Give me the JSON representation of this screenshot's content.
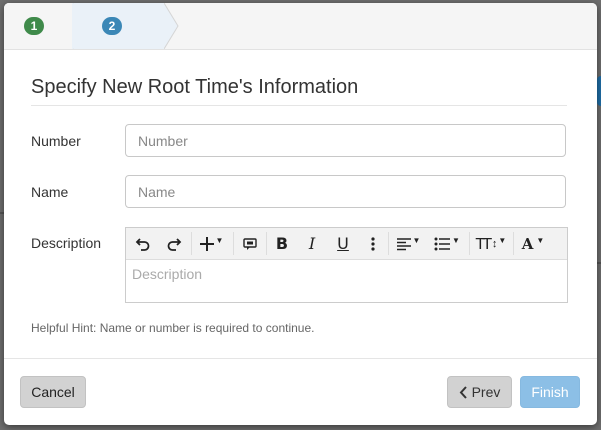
{
  "wizard": {
    "steps": [
      {
        "number": "1",
        "state": "complete",
        "color": "#3f8a4a"
      },
      {
        "number": "2",
        "state": "active",
        "color": "#3b87b6"
      }
    ]
  },
  "form": {
    "title": "Specify New Root Time's Information",
    "number": {
      "label": "Number",
      "placeholder": "Number",
      "value": ""
    },
    "name": {
      "label": "Name",
      "placeholder": "Name",
      "value": ""
    },
    "description": {
      "label": "Description",
      "placeholder": "Description"
    },
    "hint": "Helpful Hint: Name or number is required to continue."
  },
  "toolbar": {
    "undo_icon": "undo-icon",
    "redo_icon": "redo-icon",
    "insert_icon": "plus-icon",
    "comment_icon": "comment-icon",
    "bold": "B",
    "italic": "I",
    "underline": "U",
    "more_icon": "vertical-dots-icon",
    "align_icon": "align-left-icon",
    "list_icon": "bulleted-list-icon",
    "font_size": "TT",
    "font_color": "A"
  },
  "footer": {
    "cancel_label": "Cancel",
    "prev_label": "Prev",
    "finish_label": "Finish"
  },
  "colors": {
    "finish_button": "#8cbfe6",
    "secondary_button": "#d2d2d2",
    "accent": "#3b87b6"
  }
}
